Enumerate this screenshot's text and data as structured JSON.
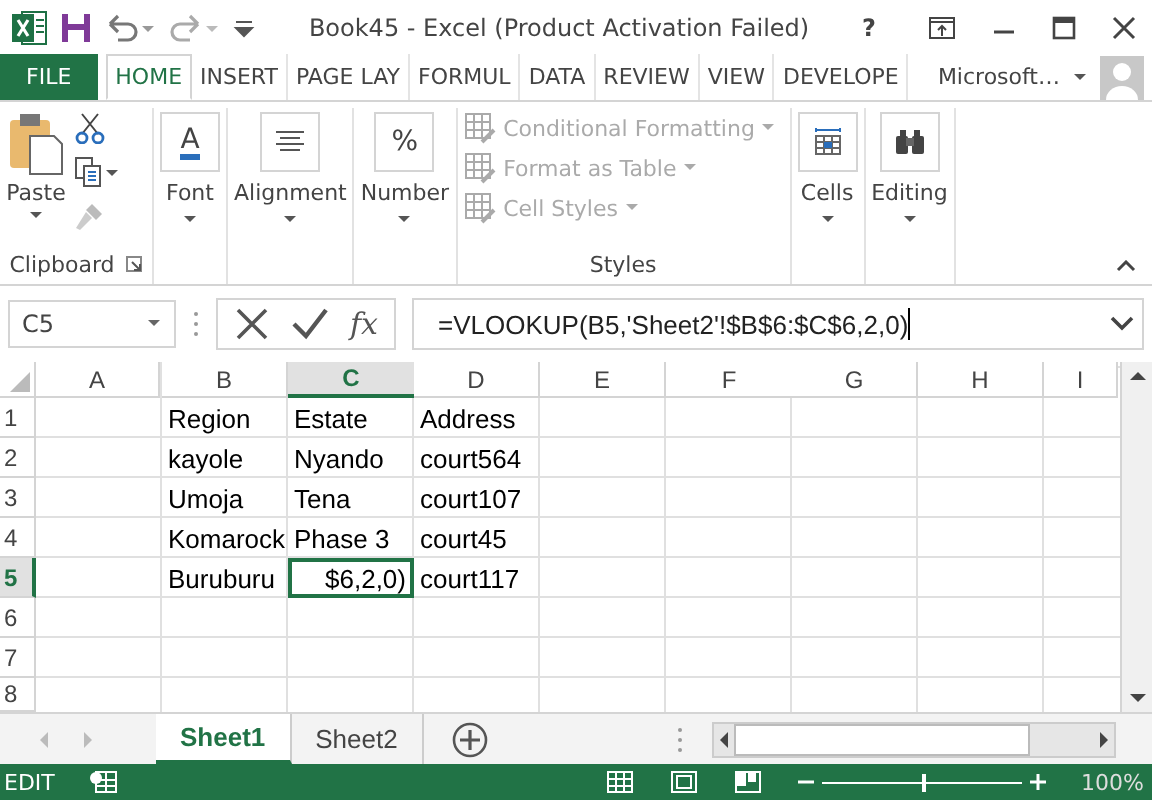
{
  "title_bar": {
    "title": "Book45 - Excel (Product Activation Failed)",
    "help": "?"
  },
  "ribbon_tabs": [
    {
      "label": "FILE",
      "kind": "file",
      "selected": false
    },
    {
      "label": "HOME",
      "kind": "tab",
      "selected": true
    },
    {
      "label": "INSERT",
      "kind": "tab",
      "selected": false
    },
    {
      "label": "PAGE LAY",
      "kind": "tab",
      "selected": false
    },
    {
      "label": "FORMUL",
      "kind": "tab",
      "selected": false
    },
    {
      "label": "DATA",
      "kind": "tab",
      "selected": false
    },
    {
      "label": "REVIEW",
      "kind": "tab",
      "selected": false
    },
    {
      "label": "VIEW",
      "kind": "tab",
      "selected": false
    },
    {
      "label": "DEVELOPE",
      "kind": "tab",
      "selected": false
    }
  ],
  "account": {
    "label": "Microsoft…"
  },
  "ribbon": {
    "clipboard": {
      "paste": "Paste",
      "label": "Clipboard"
    },
    "buttons": [
      {
        "label": "Font",
        "kind": "glyph",
        "glyph": "A"
      },
      {
        "label": "Alignment",
        "kind": "lines"
      },
      {
        "label": "Number",
        "kind": "glyph",
        "glyph": "%"
      }
    ],
    "styles": {
      "label": "Styles",
      "items": [
        {
          "label": "Conditional Formatting",
          "disabled": true
        },
        {
          "label": "Format as Table",
          "disabled": true
        },
        {
          "label": "Cell Styles",
          "disabled": true
        }
      ]
    },
    "cells": {
      "label": "Cells"
    },
    "editing": {
      "label": "Editing"
    }
  },
  "formula_bar": {
    "name_box": "C5",
    "fx": "fx",
    "formula": "=VLOOKUP(B5,'Sheet2'!$B$6:$C$6,2,0)"
  },
  "columns": [
    {
      "label": "A",
      "selected": false
    },
    {
      "label": "B",
      "selected": false
    },
    {
      "label": "C",
      "selected": true
    },
    {
      "label": "D",
      "selected": false
    },
    {
      "label": "E",
      "selected": false
    },
    {
      "label": "F",
      "selected": false
    },
    {
      "label": "G",
      "selected": false
    },
    {
      "label": "H",
      "selected": false
    },
    {
      "label": "I",
      "selected": false
    }
  ],
  "rows": [
    {
      "label": "1",
      "selected": false,
      "cells": [
        {
          "text": "Region",
          "selected": false
        },
        {
          "text": "Estate",
          "selected": false
        },
        {
          "text": "Address",
          "selected": false
        }
      ]
    },
    {
      "label": "2",
      "selected": false,
      "cells": [
        {
          "text": "kayole",
          "selected": false
        },
        {
          "text": "Nyando",
          "selected": false
        },
        {
          "text": "court564",
          "selected": false
        }
      ]
    },
    {
      "label": "3",
      "selected": false,
      "cells": [
        {
          "text": "Umoja",
          "selected": false
        },
        {
          "text": "Tena",
          "selected": false
        },
        {
          "text": "court107",
          "selected": false
        }
      ]
    },
    {
      "label": "4",
      "selected": false,
      "cells": [
        {
          "text": "Komarock",
          "selected": false
        },
        {
          "text": "Phase 3",
          "selected": false
        },
        {
          "text": "court45",
          "selected": false
        }
      ]
    },
    {
      "label": "5",
      "selected": true,
      "cells": [
        {
          "text": "Buruburu",
          "selected": false
        },
        {
          "text": "$6,2,0)",
          "selected": true
        },
        {
          "text": "court117",
          "selected": false
        }
      ]
    },
    {
      "label": "6",
      "selected": false
    },
    {
      "label": "7",
      "selected": false
    },
    {
      "label": "8",
      "selected": false
    }
  ],
  "sheet_tabs": [
    {
      "label": "Sheet1",
      "selected": true
    },
    {
      "label": "Sheet2",
      "selected": false
    }
  ],
  "status_bar": {
    "mode": "EDIT",
    "zoom": "100%",
    "zoom_level": {
      "level": 0.5
    }
  }
}
